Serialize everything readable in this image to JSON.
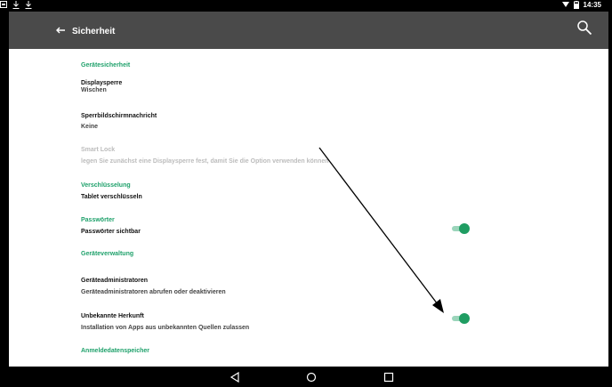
{
  "status_bar": {
    "left_icons": [
      "notification-icon",
      "download-icon",
      "download-icon"
    ],
    "time": "14:35",
    "right_icons": [
      "wifi-icon",
      "battery-icon"
    ]
  },
  "toolbar": {
    "title": "Sicherheit",
    "back_icon": "arrow-back-icon",
    "search_icon": "search-icon"
  },
  "sections": {
    "geraetesicherheit": {
      "header": "Gerätesicherheit",
      "displaysperre": {
        "title": "Displaysperre",
        "summary": "Wischen"
      },
      "sperrbild": {
        "title": "Sperrbildschirmnachricht",
        "summary": "Keine"
      },
      "smart_lock": {
        "title": "Smart Lock",
        "summary": "legen Sie zunächst eine Displaysperre fest, damit Sie die Option verwenden können",
        "enabled": false
      }
    },
    "verschluesselung": {
      "header": "Verschlüsselung",
      "item": {
        "summary": "Tablet verschlüsseln"
      }
    },
    "passwoerter": {
      "header": "Passwörter",
      "item": {
        "summary": "Passwörter sichtbar",
        "toggle_on": true
      }
    },
    "geraeteverwaltung": {
      "header": "Geräteverwaltung",
      "admins": {
        "title": "Geräteadministratoren",
        "summary": "Geräteadministratoren abrufen oder deaktivieren"
      },
      "unbekannte": {
        "title": "Unbekannte Herkunft",
        "summary": "Installation von Apps aus unbekannten Quellen zulassen",
        "toggle_on": true
      }
    },
    "anmeldedaten": {
      "header": "Anmeldedatenspeicher"
    }
  },
  "nav_bar": {
    "back_icon": "nav-back-icon",
    "home_icon": "nav-home-icon",
    "recents_icon": "nav-recents-icon"
  },
  "colors": {
    "accent": "#1fa16b",
    "toolbar": "#4a4a4a",
    "toggle_thumb": "#1f9d62",
    "toggle_track": "#9bd5bb"
  }
}
